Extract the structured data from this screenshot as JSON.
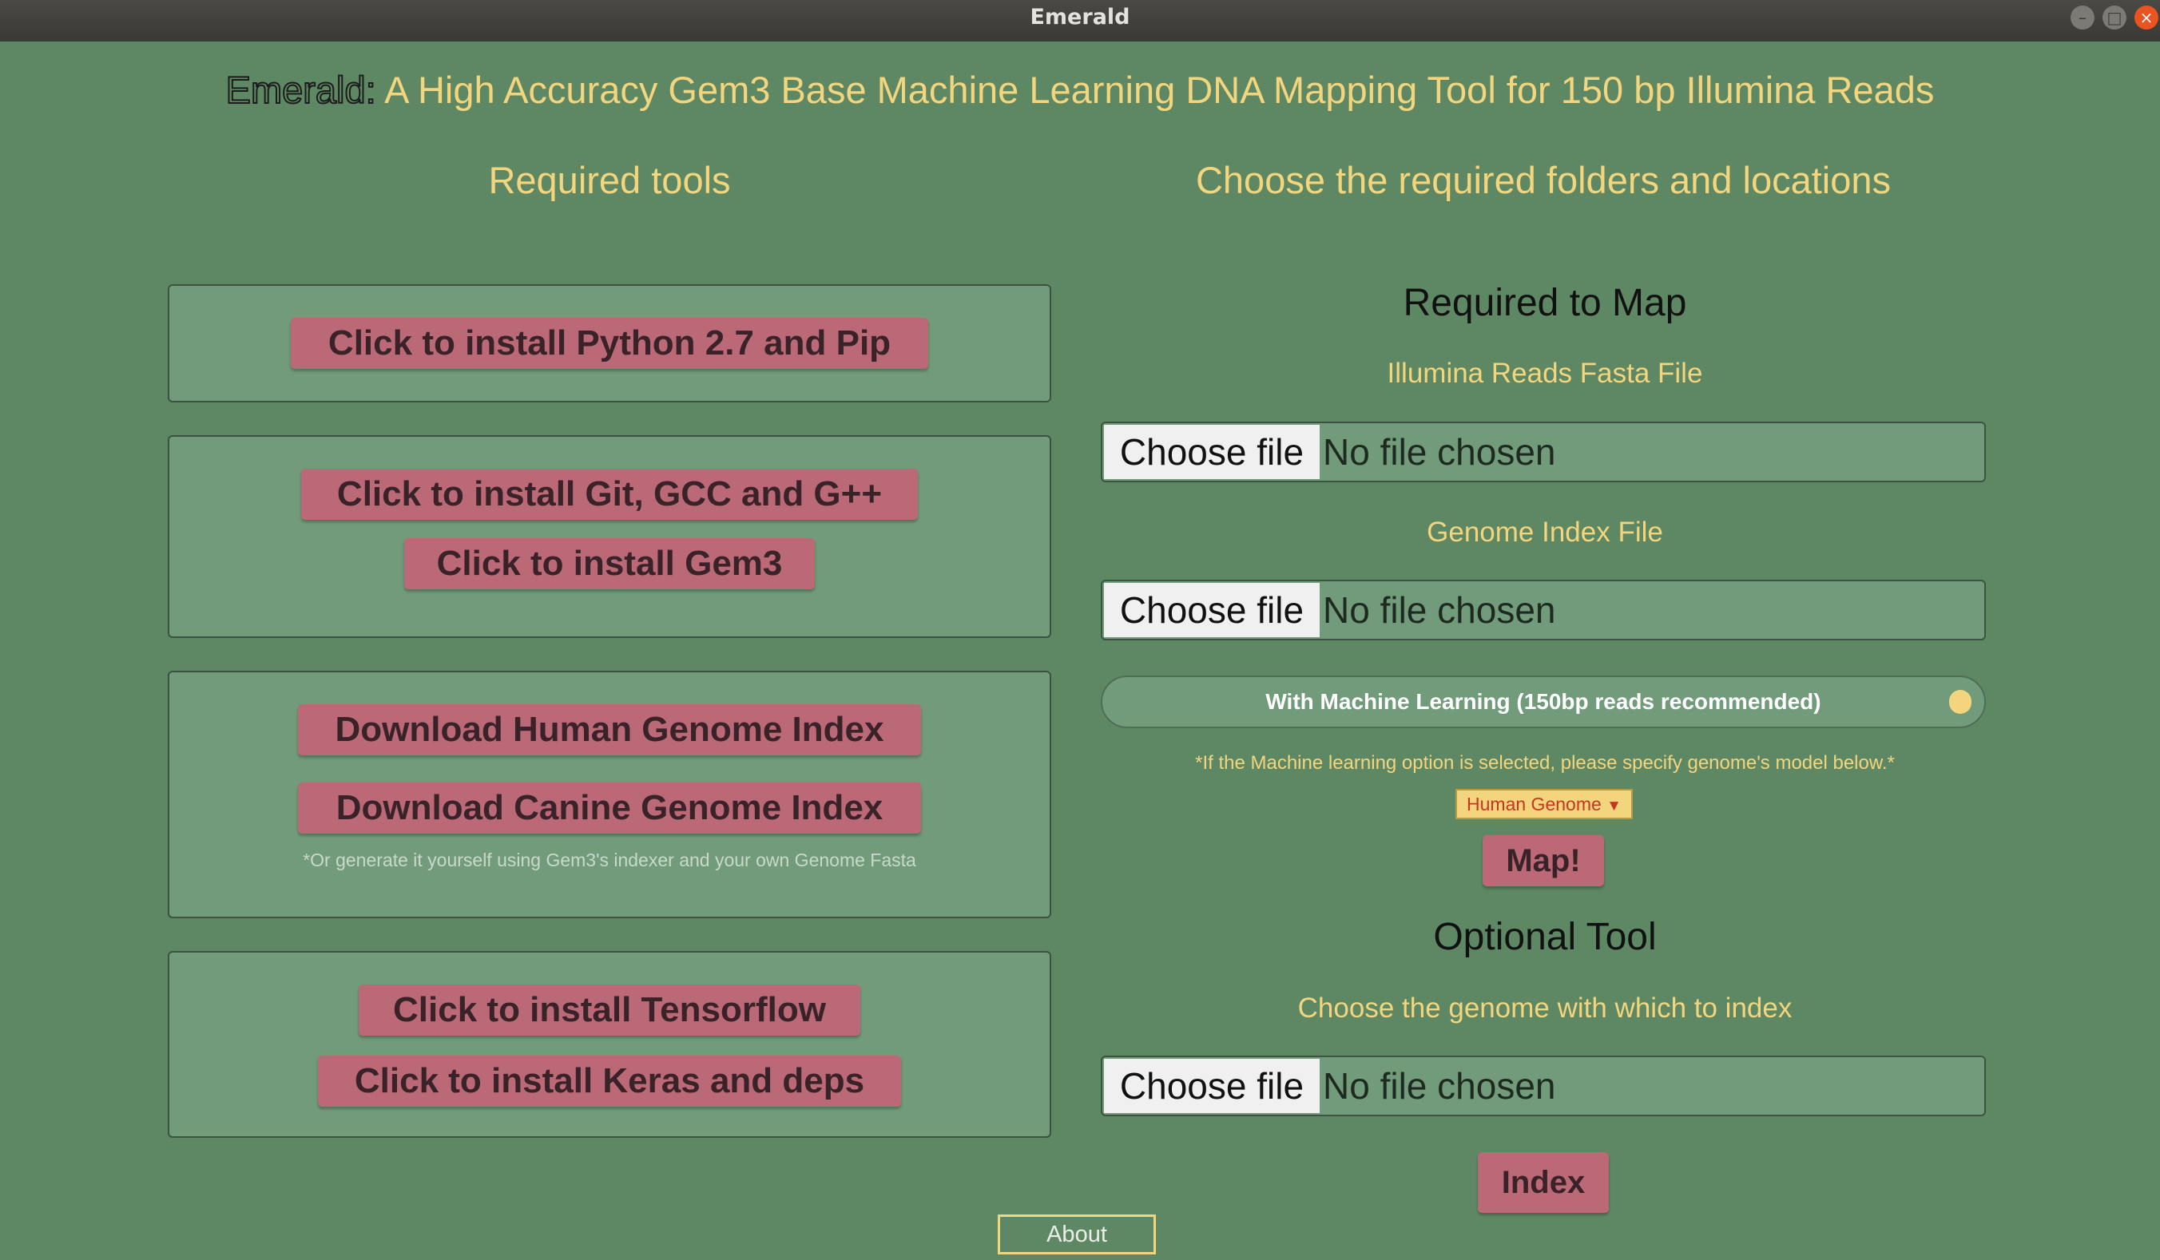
{
  "window": {
    "title": "Emerald"
  },
  "header": {
    "brand": "Emerald:",
    "title": " A High Accuracy Gem3 Base Machine Learning DNA Mapping Tool for 150 bp Illumina Reads"
  },
  "left": {
    "heading": "Required tools",
    "python_btn": "Click to install Python 2.7 and Pip",
    "git_btn": "Click to install Git, GCC and G++",
    "gem3_btn": "Click to install Gem3",
    "human_btn": "Download Human Genome Index",
    "canine_btn": "Download Canine Genome Index",
    "index_note": "*Or generate it yourself using Gem3's indexer and your own Genome Fasta",
    "tf_btn": "Click to install Tensorflow",
    "keras_btn": "Click to install Keras and deps"
  },
  "right": {
    "heading": "Choose the required folders and locations",
    "map_heading": "Required to Map",
    "reads_label": "Illumina Reads Fasta File",
    "genome_label": "Genome Index File",
    "choose_file": "Choose file",
    "no_file": "No file chosen",
    "ml_toggle": "With Machine Learning (150bp reads recommended)",
    "ml_hint": "*If the Machine learning option is selected, please specify genome's model below.*",
    "model_select": "Human Genome",
    "map_btn": "Map!",
    "optional_heading": "Optional Tool",
    "index_label": "Choose the genome with which to index",
    "index_btn": "Index"
  },
  "footer": {
    "about": "About"
  }
}
